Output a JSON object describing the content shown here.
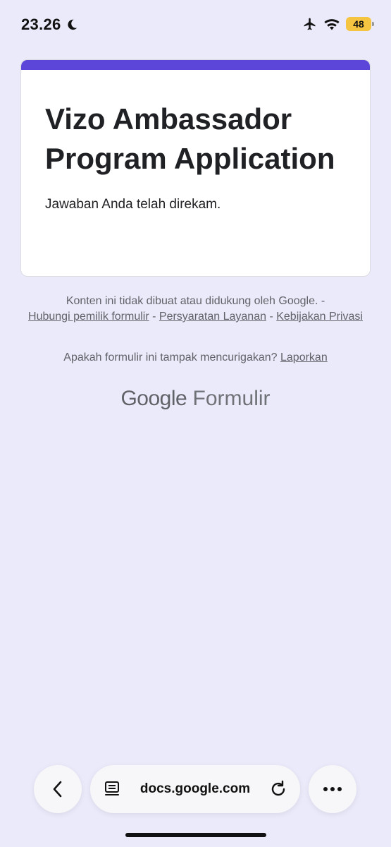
{
  "status_bar": {
    "time": "23.26",
    "battery_level": "48",
    "icons": [
      "moon-icon",
      "airplane-icon",
      "wifi-icon",
      "battery-icon"
    ]
  },
  "form": {
    "title": "Vizo Ambassador Program Application",
    "confirmation": "Jawaban Anda telah direkam.",
    "accent_color": "#5b46d9"
  },
  "footer": {
    "disclaimer": "Konten ini tidak dibuat atau didukung oleh Google. -",
    "link_contact": "Hubungi pemilik formulir",
    "sep1": "-",
    "link_terms": "Persyaratan Layanan",
    "sep2": "-",
    "link_privacy": "Kebijakan Privasi",
    "report_question": "Apakah formulir ini tampak mencurigakan?",
    "report_link": "Laporkan"
  },
  "brand": {
    "google": "Google",
    "product": "Formulir"
  },
  "browser": {
    "url": "docs.google.com",
    "icons": [
      "back-icon",
      "page-icon",
      "reload-icon",
      "more-icon"
    ]
  }
}
